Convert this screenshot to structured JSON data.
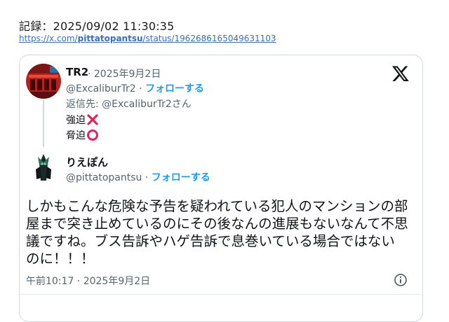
{
  "record": {
    "label": "記録：2025/09/02 11:30:35",
    "link_prefix": "https://x.com/",
    "link_user": "pittatopantsu",
    "link_suffix": "/status/1962686165049631103"
  },
  "parent_tweet": {
    "name": "TR2",
    "date_meta": " · 2025年9月2日",
    "handle": "@ExcaliburTr2",
    "separator": " · ",
    "follow_label": "フォローする",
    "reply_to": "返信先: @ExcaliburTr2さん",
    "lines": [
      "強迫",
      "脅迫"
    ],
    "marks": [
      "cross-mark-icon",
      "circle-mark-icon"
    ]
  },
  "tweet": {
    "name": "りえぽん",
    "handle": "@pittatopantsu",
    "separator": " · ",
    "follow_label": "フォローする",
    "text": "しかもこんな危険な予告を疑われている犯人のマンションの部屋まで突き止めているのにその後なんの進展もないなんて不思議ですね。ブス告訴やハゲ告訴で息巻いている場合ではないのに！！！",
    "timestamp": "午前10:17 · 2025年9月2日"
  },
  "colors": {
    "accent": "#1d9bf0",
    "muted": "#536471",
    "link": "#3a6fb5",
    "cross": "#e0245e",
    "border": "#cfd9de"
  },
  "icons": {
    "logo": "x-logo-icon",
    "info": "info-icon"
  }
}
